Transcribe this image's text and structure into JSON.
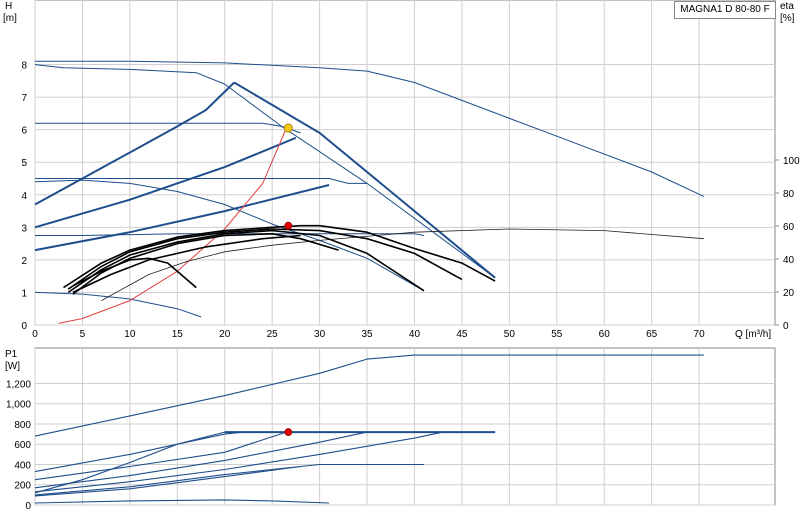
{
  "chart_data": [
    {
      "type": "line",
      "model_label": "MAGNA1 D 80-80 F",
      "ylabel_name": "H",
      "ylabel_unit": "[m]",
      "y2label_name": "eta",
      "y2label_unit": "[%]",
      "xlabel": "Q [m³/h]",
      "xlim": [
        0,
        78
      ],
      "ylim": [
        0,
        9
      ],
      "y2lim": [
        0,
        100
      ],
      "xticks": [
        0,
        5,
        10,
        15,
        20,
        25,
        30,
        35,
        40,
        45,
        50,
        55,
        60,
        65,
        70
      ],
      "yticks": [
        0,
        1,
        2,
        3,
        4,
        5,
        6,
        7,
        8
      ],
      "y2ticks": [
        0,
        20,
        40,
        60,
        80,
        100
      ],
      "grid": true,
      "series": [
        {
          "role": "head",
          "points": [
            [
              0,
              8.0
            ],
            [
              3,
              7.9
            ],
            [
              10,
              7.85
            ],
            [
              17,
              7.75
            ],
            [
              20,
              7.4
            ],
            [
              26,
              6.1
            ],
            [
              35,
              4.35
            ],
            [
              48.5,
              1.45
            ]
          ]
        },
        {
          "role": "head",
          "points": [
            [
              0,
              8.1
            ],
            [
              10,
              8.1
            ],
            [
              20,
              8.05
            ],
            [
              30,
              7.9
            ],
            [
              35,
              7.8
            ],
            [
              40,
              7.45
            ],
            [
              45,
              6.9
            ],
            [
              55,
              5.8
            ],
            [
              65,
              4.7
            ],
            [
              70.5,
              3.95
            ]
          ]
        },
        {
          "role": "head",
          "points": [
            [
              0,
              6.2
            ],
            [
              24,
              6.2
            ],
            [
              26,
              6.1
            ],
            [
              28,
              5.9
            ]
          ]
        },
        {
          "role": "head",
          "points": [
            [
              0,
              4.5
            ],
            [
              31,
              4.5
            ],
            [
              33,
              4.35
            ],
            [
              35,
              4.35
            ]
          ]
        },
        {
          "role": "head",
          "points": [
            [
              0,
              4.4
            ],
            [
              5,
              4.45
            ],
            [
              10,
              4.35
            ],
            [
              15,
              4.1
            ],
            [
              20,
              3.7
            ],
            [
              25,
              3.1
            ],
            [
              30,
              2.6
            ],
            [
              35,
              2.05
            ],
            [
              41,
              1.05
            ]
          ]
        },
        {
          "role": "head",
          "points": [
            [
              0,
              2.75
            ],
            [
              5,
              2.75
            ],
            [
              15,
              2.8
            ],
            [
              25,
              2.8
            ],
            [
              30,
              2.8
            ],
            [
              35,
              2.8
            ],
            [
              40,
              2.8
            ],
            [
              41,
              2.75
            ]
          ]
        },
        {
          "role": "head",
          "points": [
            [
              0,
              1.0
            ],
            [
              5,
              0.95
            ],
            [
              10,
              0.8
            ],
            [
              15,
              0.5
            ],
            [
              17.5,
              0.25
            ]
          ]
        },
        {
          "role": "control",
          "points": [
            [
              0,
              3.7
            ],
            [
              5,
              4.5
            ],
            [
              10,
              5.3
            ],
            [
              15,
              6.1
            ],
            [
              18,
              6.6
            ],
            [
              21,
              7.45
            ]
          ]
        },
        {
          "role": "control",
          "points": [
            [
              0,
              3.0
            ],
            [
              10,
              3.85
            ],
            [
              20,
              4.85
            ],
            [
              27.5,
              5.75
            ]
          ]
        },
        {
          "role": "control",
          "points": [
            [
              0,
              2.3
            ],
            [
              10,
              2.85
            ],
            [
              20,
              3.5
            ],
            [
              31,
              4.3
            ]
          ]
        },
        {
          "role": "control",
          "points": [
            [
              21,
              7.45
            ],
            [
              30,
              5.9
            ],
            [
              40,
              3.5
            ],
            [
              48.5,
              1.45
            ]
          ]
        },
        {
          "role": "system",
          "points": [
            [
              2.5,
              0.05
            ],
            [
              5,
              0.2
            ],
            [
              10,
              0.75
            ],
            [
              15,
              1.65
            ],
            [
              20,
              2.95
            ],
            [
              24,
              4.35
            ],
            [
              26.5,
              6.05
            ]
          ]
        },
        {
          "role": "setpoint",
          "points": [
            [
              7,
              0.75
            ],
            [
              12,
              1.55
            ],
            [
              16,
              1.95
            ],
            [
              20,
              2.25
            ],
            [
              25,
              2.45
            ],
            [
              30,
              2.6
            ],
            [
              40,
              2.85
            ],
            [
              50,
              2.95
            ],
            [
              60,
              2.9
            ],
            [
              70.5,
              2.65
            ]
          ]
        },
        {
          "role": "efficiency",
          "points": [
            [
              3,
              1.15
            ],
            [
              7,
              1.9
            ],
            [
              10,
              2.3
            ],
            [
              15,
              2.7
            ],
            [
              20,
              2.9
            ],
            [
              25,
              3.0
            ],
            [
              28,
              3.05
            ],
            [
              30,
              3.05
            ],
            [
              35,
              2.85
            ],
            [
              40,
              2.35
            ],
            [
              45,
              1.9
            ],
            [
              48.5,
              1.35
            ]
          ]
        },
        {
          "role": "efficiency",
          "points": [
            [
              3.5,
              1.1
            ],
            [
              7,
              1.8
            ],
            [
              10,
              2.25
            ],
            [
              15,
              2.65
            ],
            [
              20,
              2.85
            ],
            [
              25,
              2.95
            ],
            [
              30,
              2.9
            ],
            [
              35,
              2.65
            ],
            [
              40,
              2.2
            ],
            [
              45,
              1.4
            ]
          ]
        },
        {
          "role": "efficiency",
          "points": [
            [
              3.5,
              1.0
            ],
            [
              7,
              1.7
            ],
            [
              10,
              2.15
            ],
            [
              15,
              2.55
            ],
            [
              20,
              2.8
            ],
            [
              25,
              2.9
            ],
            [
              30,
              2.75
            ],
            [
              35,
              2.2
            ],
            [
              41,
              1.05
            ]
          ]
        },
        {
          "role": "efficiency",
          "points": [
            [
              4,
              0.95
            ],
            [
              7,
              1.6
            ],
            [
              10,
              2.05
            ],
            [
              15,
              2.5
            ],
            [
              20,
              2.75
            ],
            [
              25,
              2.8
            ],
            [
              28,
              2.65
            ],
            [
              32,
              2.3
            ]
          ]
        },
        {
          "role": "efficiency",
          "points": [
            [
              4,
              1.2
            ],
            [
              7,
              1.65
            ],
            [
              10,
              2.0
            ],
            [
              12,
              2.05
            ],
            [
              14,
              1.9
            ],
            [
              17,
              1.15
            ]
          ]
        },
        {
          "role": "efficiency",
          "points": [
            [
              4,
              1.0
            ],
            [
              8,
              1.55
            ],
            [
              12,
              2.0
            ],
            [
              18,
              2.4
            ],
            [
              24,
              2.65
            ],
            [
              28,
              2.75
            ]
          ]
        }
      ],
      "duty_point": {
        "q": 26.7,
        "h": 3.05
      },
      "intersection_point": {
        "q": 26.7,
        "h": 6.05
      }
    },
    {
      "type": "line",
      "ylabel_name": "P1",
      "ylabel_unit": "[W]",
      "xlim": [
        0,
        78
      ],
      "ylim": [
        0,
        1550
      ],
      "yticks": [
        0,
        200,
        400,
        600,
        800,
        1000,
        1200
      ],
      "ytick_labels": [
        "0",
        "200",
        "400",
        "600",
        "800",
        "1,000",
        "1,200"
      ],
      "grid": true,
      "series": [
        {
          "role": "power",
          "points": [
            [
              0,
              680
            ],
            [
              10,
              880
            ],
            [
              20,
              1080
            ],
            [
              30,
              1300
            ],
            [
              35,
              1440
            ],
            [
              40,
              1480
            ],
            [
              50,
              1480
            ],
            [
              60,
              1480
            ],
            [
              70.5,
              1480
            ]
          ]
        },
        {
          "role": "power",
          "points": [
            [
              0,
              120
            ],
            [
              5,
              250
            ],
            [
              10,
              420
            ],
            [
              15,
              600
            ],
            [
              20,
              720
            ],
            [
              26.5,
              720
            ],
            [
              30,
              720
            ],
            [
              48.5,
              720
            ]
          ]
        },
        {
          "role": "power",
          "points": [
            [
              0,
              330
            ],
            [
              10,
              500
            ],
            [
              15,
              600
            ],
            [
              20,
              700
            ],
            [
              22,
              720
            ]
          ]
        },
        {
          "role": "power",
          "points": [
            [
              0,
              250
            ],
            [
              10,
              380
            ],
            [
              20,
              520
            ],
            [
              26.5,
              720
            ]
          ]
        },
        {
          "role": "power",
          "points": [
            [
              0,
              170
            ],
            [
              10,
              290
            ],
            [
              20,
              440
            ],
            [
              30,
              620
            ],
            [
              35,
              720
            ]
          ]
        },
        {
          "role": "power",
          "points": [
            [
              0,
              130
            ],
            [
              10,
              230
            ],
            [
              20,
              350
            ],
            [
              30,
              500
            ],
            [
              40,
              660
            ],
            [
              43,
              720
            ]
          ]
        },
        {
          "role": "power",
          "points": [
            [
              0,
              100
            ],
            [
              10,
              180
            ],
            [
              20,
              300
            ],
            [
              30,
              400
            ],
            [
              41,
              400
            ]
          ]
        },
        {
          "role": "power",
          "points": [
            [
              0,
              90
            ],
            [
              10,
              160
            ],
            [
              20,
              280
            ],
            [
              28,
              380
            ]
          ]
        },
        {
          "role": "power",
          "points": [
            [
              0,
              20
            ],
            [
              10,
              40
            ],
            [
              20,
              50
            ],
            [
              25,
              40
            ],
            [
              31,
              20
            ]
          ]
        }
      ],
      "duty_point": {
        "q": 26.7,
        "p": 720
      }
    }
  ]
}
